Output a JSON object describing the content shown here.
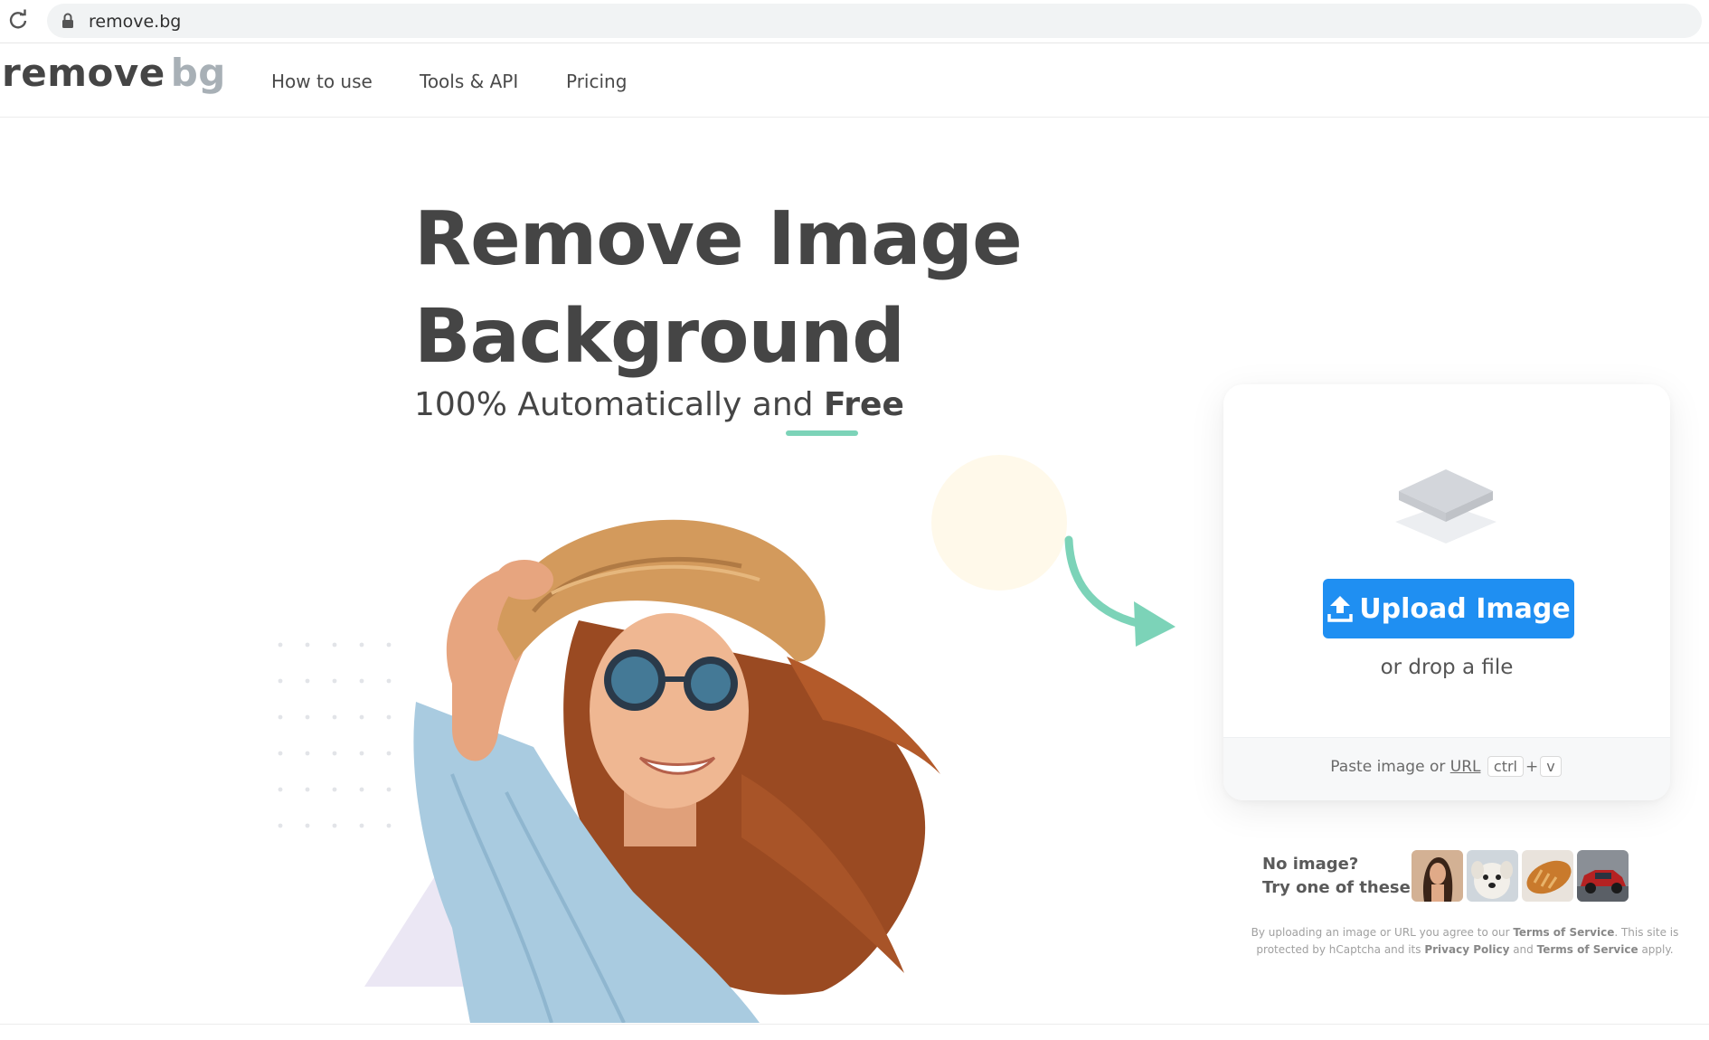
{
  "browser": {
    "url": "remove.bg"
  },
  "header": {
    "logo_part1": "remove",
    "logo_part2": "bg",
    "nav": [
      {
        "label": "How to use"
      },
      {
        "label": "Tools & API"
      },
      {
        "label": "Pricing"
      }
    ]
  },
  "hero": {
    "headline_line1": "Remove Image",
    "headline_line2": "Background",
    "subline_prefix": "100% Automatically and ",
    "subline_emphasis": "Free"
  },
  "upload_card": {
    "button_label": "Upload Image",
    "drop_text": "or drop a file",
    "paste_prefix": "Paste image or ",
    "paste_link": "URL",
    "key_ctrl": "ctrl",
    "key_plus": "+",
    "key_v": "v"
  },
  "samples": {
    "line1": "No image?",
    "line2": "Try one of these:",
    "items": [
      {
        "icon": "sample-woman-photo"
      },
      {
        "icon": "sample-dog-photo"
      },
      {
        "icon": "sample-bread-photo"
      },
      {
        "icon": "sample-car-photo"
      }
    ]
  },
  "legal": {
    "part1": "By uploading an image or URL you agree to our ",
    "terms1": "Terms of Service",
    "part2": ". This site is protected by hCaptcha and its ",
    "privacy": "Privacy Policy",
    "part3": " and ",
    "terms2": "Terms of Service",
    "part4": " apply."
  },
  "colors": {
    "accent_blue": "#1f8ff2",
    "accent_green": "#7cd3b8",
    "text_dark": "#454545",
    "logo_gray": "#a8b0b6"
  }
}
